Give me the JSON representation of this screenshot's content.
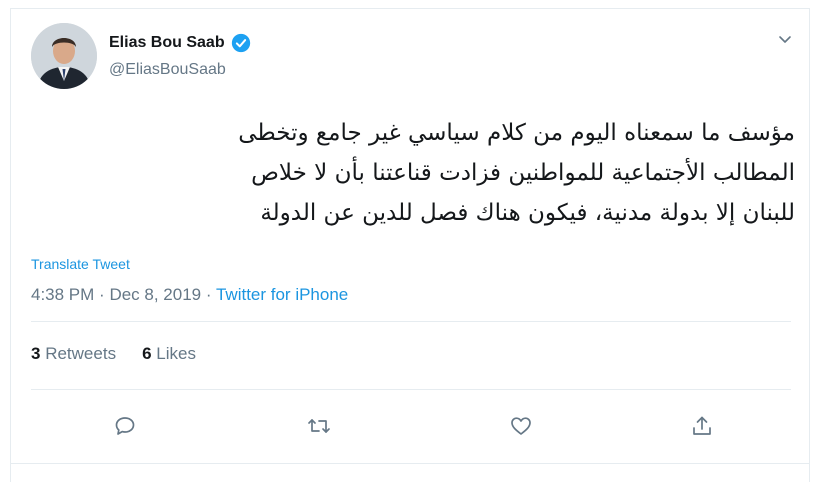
{
  "author": {
    "name": "Elias Bou Saab",
    "handle": "@EliasBouSaab",
    "verified_icon": "verified-badge-icon"
  },
  "tweet": {
    "lines": [
      "مؤسف ما سمعناه اليوم من كلام سياسي غير جامع وتخطى",
      "المطالب الأجتماعية للمواطنين فزادت قناعتنا بأن لا خلاص",
      "للبنان إلا بدولة مدنية، فيكون هناك فصل للدين عن الدولة"
    ],
    "translate_label": "Translate Tweet",
    "time": "4:38 PM",
    "separator": "·",
    "date": "Dec 8, 2019",
    "source": "Twitter for iPhone"
  },
  "stats": {
    "retweets_count": "3",
    "retweets_label": "Retweets",
    "likes_count": "6",
    "likes_label": "Likes"
  },
  "actions": {
    "reply_icon": "reply-icon",
    "retweet_icon": "retweet-icon",
    "like_icon": "heart-icon",
    "share_icon": "share-icon"
  },
  "colors": {
    "link": "#1b95e0",
    "muted": "#657786",
    "text": "#14171a",
    "border": "#e6ecf0"
  }
}
